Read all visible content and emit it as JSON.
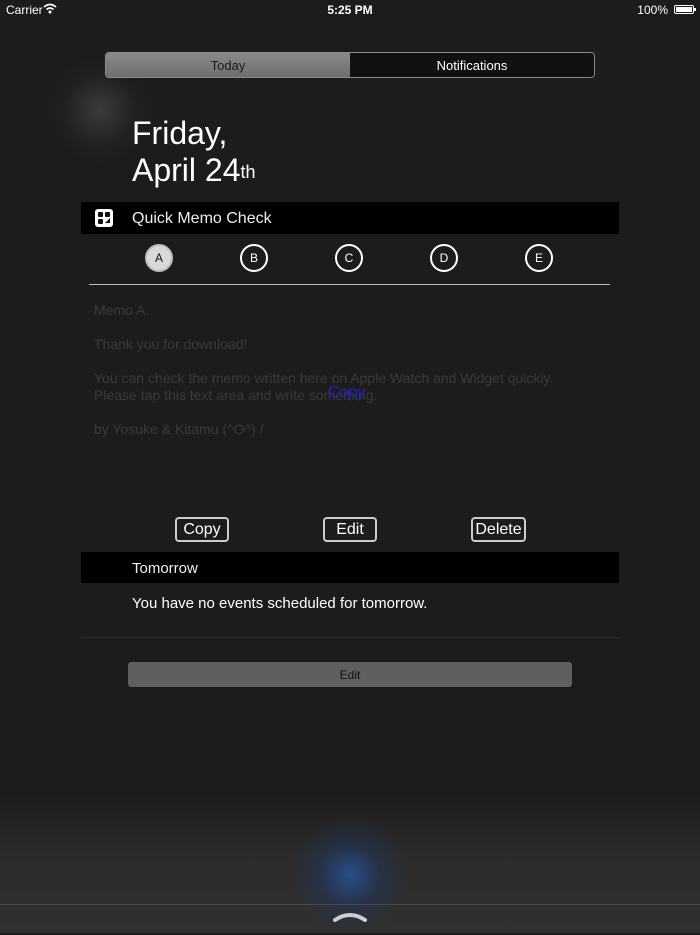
{
  "status_bar": {
    "carrier": "Carrier",
    "time": "5:25 PM",
    "battery": "100%"
  },
  "segmented": {
    "today": "Today",
    "notifications": "Notifications"
  },
  "date": {
    "line1": "Friday,",
    "line2": "April 24",
    "suffix": "th"
  },
  "widget": {
    "title": "Quick Memo Check",
    "tabs": [
      "A",
      "B",
      "C",
      "D",
      "E"
    ],
    "memo_lines": [
      "Memo A",
      "",
      "Thank you for download!",
      "",
      "You can check the memo written here on Apple Watch and Widget quickly.",
      "Please tap this text area and write something.",
      "",
      "by Yosuke & Kitamu (^O^) /"
    ],
    "copy_popup": "Copy",
    "buttons": {
      "copy": "Copy",
      "edit": "Edit",
      "delete": "Delete"
    }
  },
  "tomorrow": {
    "title": "Tomorrow",
    "message": "You have no events scheduled for tomorrow."
  },
  "edit_button": "Edit"
}
